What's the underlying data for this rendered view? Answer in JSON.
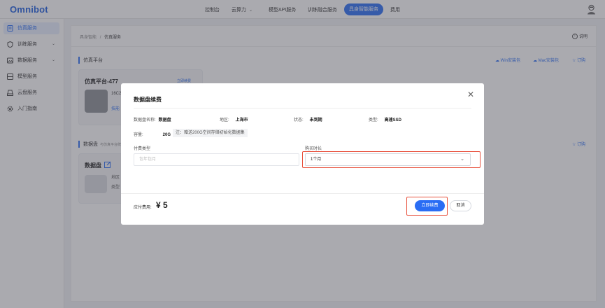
{
  "brand": "Omnibot",
  "nav": {
    "items": [
      "控制台",
      "云算力",
      "模型API服务",
      "训练融合服务",
      "具身智能服务",
      "费用"
    ],
    "active": "具身智能服务"
  },
  "sidebar": {
    "items": [
      {
        "label": "仿真服务",
        "icon": "simulation-icon"
      },
      {
        "label": "训练服务",
        "icon": "shield-icon"
      },
      {
        "label": "数据服务",
        "icon": "image-icon"
      },
      {
        "label": "模型服务",
        "icon": "model-icon"
      },
      {
        "label": "云盘服务",
        "icon": "disk-icon"
      },
      {
        "label": "入门指南",
        "icon": "gear-icon"
      }
    ]
  },
  "main": {
    "breadcrumb": {
      "parent": "具身智能",
      "separator": "/",
      "current": "仿真服务"
    },
    "help": "说明",
    "platform_section": {
      "title": "仿真平台",
      "links": [
        "Win安装包",
        "Mac安装包",
        "订购"
      ]
    },
    "platform_card": {
      "title": "仿真平台-477",
      "renew": "立即续费",
      "spec": "16C2",
      "link": "技能"
    },
    "disk_section": {
      "title": "数据盘",
      "subtitle": "与仿真平台统一",
      "order": "订购"
    },
    "disk_card": {
      "title": "数据盘",
      "region_prefix": "地区",
      "type_prefix": "类型"
    }
  },
  "modal": {
    "title": "数据盘续费",
    "info": {
      "name_label": "数据盘名称:",
      "name_value": "数据盘",
      "region_label": "地区:",
      "region_value": "上海市",
      "status_label": "状态:",
      "status_value": "未到期",
      "type_label": "类型:",
      "type_value": "高速SSD",
      "capacity_label": "容量:",
      "capacity_value": "20G",
      "note": "注：赠送200G空间存储初始化数据集"
    },
    "pay_type_label": "付费类型",
    "pay_type_placeholder": "包年包月",
    "duration_label": "购买时长",
    "duration_value": "1个月",
    "fee_label": "应付费用:",
    "fee_value": "¥ 5",
    "confirm_label": "立即续费",
    "cancel_label": "取消"
  },
  "colors": {
    "primary": "#2a6df4",
    "highlight": "#e8533f",
    "overlay": "rgba(70,70,80,0.46)"
  }
}
